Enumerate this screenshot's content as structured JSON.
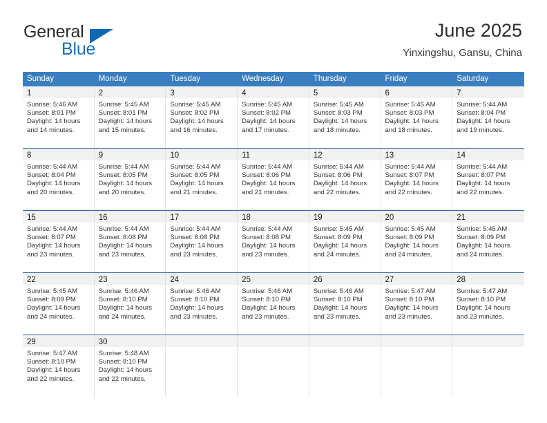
{
  "brand": {
    "name_part1": "General",
    "name_part2": "Blue",
    "triangle_icon": "triangle-logo-icon",
    "accent_color": "#1069b4"
  },
  "header": {
    "title": "June 2025",
    "subtitle": "Yinxingshu, Gansu, China"
  },
  "theme": {
    "header_row_bg": "#3a7ec0",
    "week_divider": "#2f6ca8",
    "daynum_bg": "#f1f1f1",
    "cell_border": "#e2e2e2"
  },
  "calendar": {
    "day_headers": [
      "Sunday",
      "Monday",
      "Tuesday",
      "Wednesday",
      "Thursday",
      "Friday",
      "Saturday"
    ],
    "weeks": [
      [
        {
          "day": "1",
          "sunrise": "Sunrise: 5:46 AM",
          "sunset": "Sunset: 8:01 PM",
          "daylight": "Daylight: 14 hours and 14 minutes."
        },
        {
          "day": "2",
          "sunrise": "Sunrise: 5:45 AM",
          "sunset": "Sunset: 8:01 PM",
          "daylight": "Daylight: 14 hours and 15 minutes."
        },
        {
          "day": "3",
          "sunrise": "Sunrise: 5:45 AM",
          "sunset": "Sunset: 8:02 PM",
          "daylight": "Daylight: 14 hours and 16 minutes."
        },
        {
          "day": "4",
          "sunrise": "Sunrise: 5:45 AM",
          "sunset": "Sunset: 8:02 PM",
          "daylight": "Daylight: 14 hours and 17 minutes."
        },
        {
          "day": "5",
          "sunrise": "Sunrise: 5:45 AM",
          "sunset": "Sunset: 8:03 PM",
          "daylight": "Daylight: 14 hours and 18 minutes."
        },
        {
          "day": "6",
          "sunrise": "Sunrise: 5:45 AM",
          "sunset": "Sunset: 8:03 PM",
          "daylight": "Daylight: 14 hours and 18 minutes."
        },
        {
          "day": "7",
          "sunrise": "Sunrise: 5:44 AM",
          "sunset": "Sunset: 8:04 PM",
          "daylight": "Daylight: 14 hours and 19 minutes."
        }
      ],
      [
        {
          "day": "8",
          "sunrise": "Sunrise: 5:44 AM",
          "sunset": "Sunset: 8:04 PM",
          "daylight": "Daylight: 14 hours and 20 minutes."
        },
        {
          "day": "9",
          "sunrise": "Sunrise: 5:44 AM",
          "sunset": "Sunset: 8:05 PM",
          "daylight": "Daylight: 14 hours and 20 minutes."
        },
        {
          "day": "10",
          "sunrise": "Sunrise: 5:44 AM",
          "sunset": "Sunset: 8:05 PM",
          "daylight": "Daylight: 14 hours and 21 minutes."
        },
        {
          "day": "11",
          "sunrise": "Sunrise: 5:44 AM",
          "sunset": "Sunset: 8:06 PM",
          "daylight": "Daylight: 14 hours and 21 minutes."
        },
        {
          "day": "12",
          "sunrise": "Sunrise: 5:44 AM",
          "sunset": "Sunset: 8:06 PM",
          "daylight": "Daylight: 14 hours and 22 minutes."
        },
        {
          "day": "13",
          "sunrise": "Sunrise: 5:44 AM",
          "sunset": "Sunset: 8:07 PM",
          "daylight": "Daylight: 14 hours and 22 minutes."
        },
        {
          "day": "14",
          "sunrise": "Sunrise: 5:44 AM",
          "sunset": "Sunset: 8:07 PM",
          "daylight": "Daylight: 14 hours and 22 minutes."
        }
      ],
      [
        {
          "day": "15",
          "sunrise": "Sunrise: 5:44 AM",
          "sunset": "Sunset: 8:07 PM",
          "daylight": "Daylight: 14 hours and 23 minutes."
        },
        {
          "day": "16",
          "sunrise": "Sunrise: 5:44 AM",
          "sunset": "Sunset: 8:08 PM",
          "daylight": "Daylight: 14 hours and 23 minutes."
        },
        {
          "day": "17",
          "sunrise": "Sunrise: 5:44 AM",
          "sunset": "Sunset: 8:08 PM",
          "daylight": "Daylight: 14 hours and 23 minutes."
        },
        {
          "day": "18",
          "sunrise": "Sunrise: 5:44 AM",
          "sunset": "Sunset: 8:08 PM",
          "daylight": "Daylight: 14 hours and 23 minutes."
        },
        {
          "day": "19",
          "sunrise": "Sunrise: 5:45 AM",
          "sunset": "Sunset: 8:09 PM",
          "daylight": "Daylight: 14 hours and 24 minutes."
        },
        {
          "day": "20",
          "sunrise": "Sunrise: 5:45 AM",
          "sunset": "Sunset: 8:09 PM",
          "daylight": "Daylight: 14 hours and 24 minutes."
        },
        {
          "day": "21",
          "sunrise": "Sunrise: 5:45 AM",
          "sunset": "Sunset: 8:09 PM",
          "daylight": "Daylight: 14 hours and 24 minutes."
        }
      ],
      [
        {
          "day": "22",
          "sunrise": "Sunrise: 5:45 AM",
          "sunset": "Sunset: 8:09 PM",
          "daylight": "Daylight: 14 hours and 24 minutes."
        },
        {
          "day": "23",
          "sunrise": "Sunrise: 5:46 AM",
          "sunset": "Sunset: 8:10 PM",
          "daylight": "Daylight: 14 hours and 24 minutes."
        },
        {
          "day": "24",
          "sunrise": "Sunrise: 5:46 AM",
          "sunset": "Sunset: 8:10 PM",
          "daylight": "Daylight: 14 hours and 23 minutes."
        },
        {
          "day": "25",
          "sunrise": "Sunrise: 5:46 AM",
          "sunset": "Sunset: 8:10 PM",
          "daylight": "Daylight: 14 hours and 23 minutes."
        },
        {
          "day": "26",
          "sunrise": "Sunrise: 5:46 AM",
          "sunset": "Sunset: 8:10 PM",
          "daylight": "Daylight: 14 hours and 23 minutes."
        },
        {
          "day": "27",
          "sunrise": "Sunrise: 5:47 AM",
          "sunset": "Sunset: 8:10 PM",
          "daylight": "Daylight: 14 hours and 23 minutes."
        },
        {
          "day": "28",
          "sunrise": "Sunrise: 5:47 AM",
          "sunset": "Sunset: 8:10 PM",
          "daylight": "Daylight: 14 hours and 23 minutes."
        }
      ],
      [
        {
          "day": "29",
          "sunrise": "Sunrise: 5:47 AM",
          "sunset": "Sunset: 8:10 PM",
          "daylight": "Daylight: 14 hours and 22 minutes."
        },
        {
          "day": "30",
          "sunrise": "Sunrise: 5:48 AM",
          "sunset": "Sunset: 8:10 PM",
          "daylight": "Daylight: 14 hours and 22 minutes."
        },
        {
          "day": "",
          "sunrise": "",
          "sunset": "",
          "daylight": ""
        },
        {
          "day": "",
          "sunrise": "",
          "sunset": "",
          "daylight": ""
        },
        {
          "day": "",
          "sunrise": "",
          "sunset": "",
          "daylight": ""
        },
        {
          "day": "",
          "sunrise": "",
          "sunset": "",
          "daylight": ""
        },
        {
          "day": "",
          "sunrise": "",
          "sunset": "",
          "daylight": ""
        }
      ]
    ]
  }
}
